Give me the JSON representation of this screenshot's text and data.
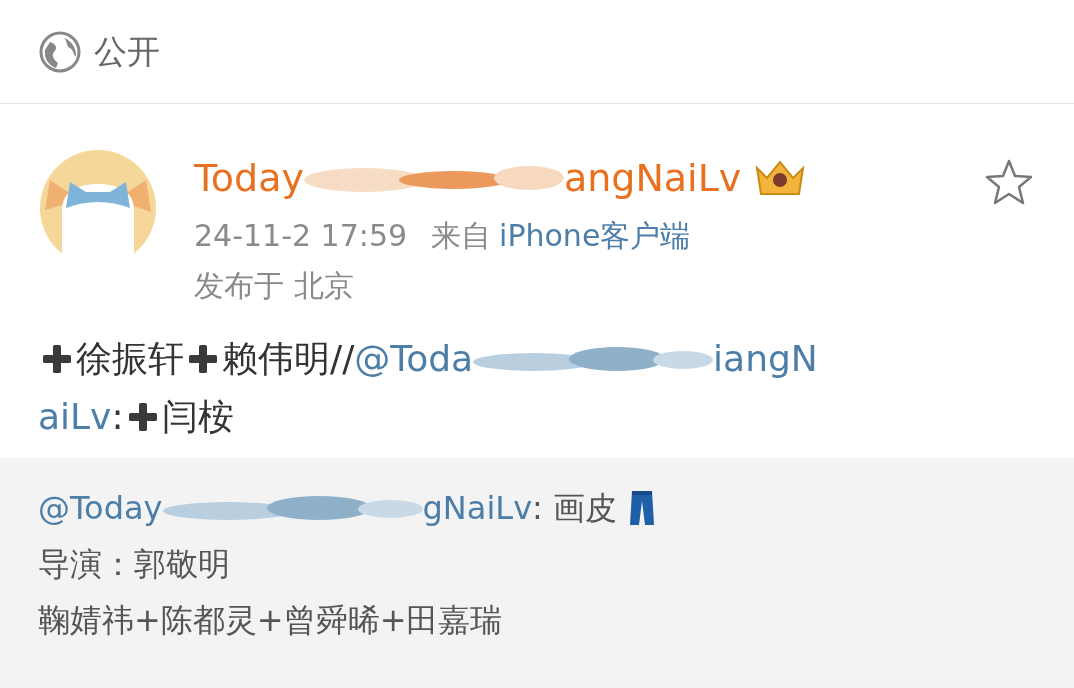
{
  "visibility": {
    "label": "公开"
  },
  "post": {
    "author": {
      "name_start": "Today",
      "name_end": "angNaiLv"
    },
    "time": "24-11-2 17:59",
    "source_prefix": "来自",
    "source": "iPhone客户端",
    "location": "发布于 北京",
    "body": {
      "lines": [
        [
          {
            "kind": "plus"
          },
          {
            "kind": "text",
            "text": "徐振轩"
          },
          {
            "kind": "plus"
          },
          {
            "kind": "text",
            "text": "赖伟明//"
          },
          {
            "kind": "mention",
            "text": "@Toda"
          },
          {
            "kind": "smudge"
          },
          {
            "kind": "mention",
            "text": "iangN"
          }
        ],
        [
          {
            "kind": "mention",
            "text": "aiLv"
          },
          {
            "kind": "text",
            "text": ":"
          },
          {
            "kind": "plus"
          },
          {
            "kind": "text",
            "text": "闫桉"
          }
        ]
      ]
    },
    "quote": {
      "lines": [
        [
          {
            "kind": "mention",
            "text": "@Today"
          },
          {
            "kind": "smudge"
          },
          {
            "kind": "mention",
            "text": "gNaiLv"
          },
          {
            "kind": "text",
            "text": ": 画皮"
          },
          {
            "kind": "jeans"
          }
        ],
        [
          {
            "kind": "text",
            "text": "导演：郭敬明"
          }
        ],
        [
          {
            "kind": "text",
            "text": "鞠婧祎+陈都灵+曾舜晞+田嘉瑞"
          }
        ]
      ]
    }
  }
}
